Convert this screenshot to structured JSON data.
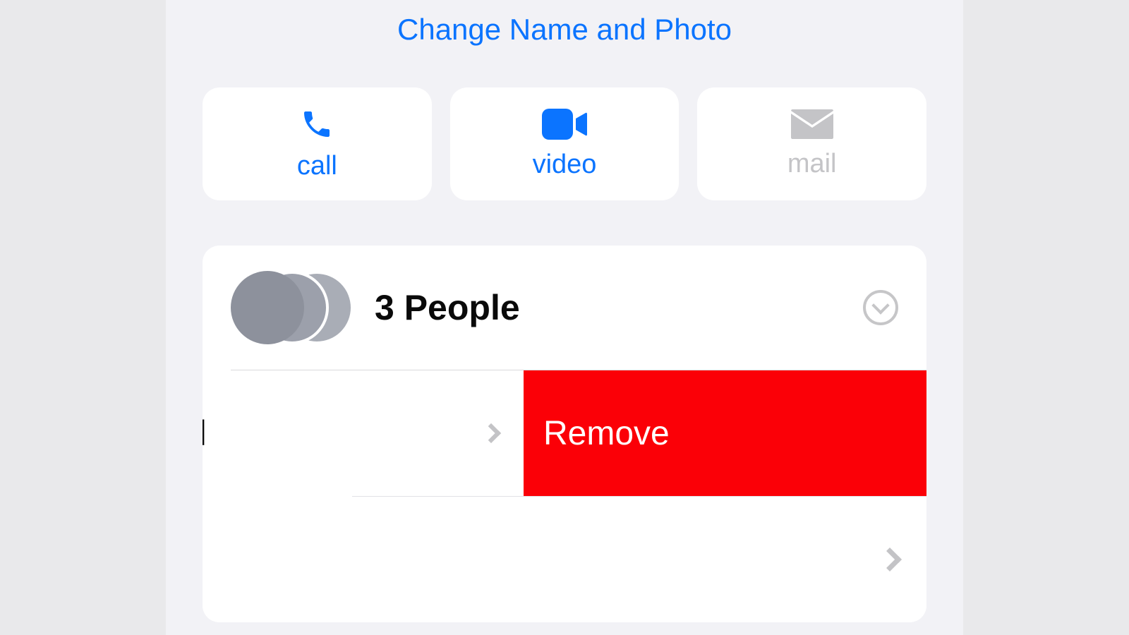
{
  "header": {
    "change_name_photo_label": "Change Name and Photo"
  },
  "actions": {
    "call": {
      "label": "call",
      "icon": "phone-icon",
      "enabled": true
    },
    "video": {
      "label": "video",
      "icon": "video-icon",
      "enabled": true
    },
    "mail": {
      "label": "mail",
      "icon": "mail-icon",
      "enabled": false
    }
  },
  "people_section": {
    "count_label": "3 People",
    "avatar_count": 3
  },
  "swiped_row": {
    "visible_text_fragment": "l",
    "remove_label": "Remove"
  },
  "colors": {
    "accent": "#0b74ff",
    "destructive": "#fb0007",
    "disabled": "#c4c4c7",
    "bg_outer": "#e9e9eb",
    "bg_device": "#f2f2f6",
    "card_bg": "#ffffff"
  }
}
